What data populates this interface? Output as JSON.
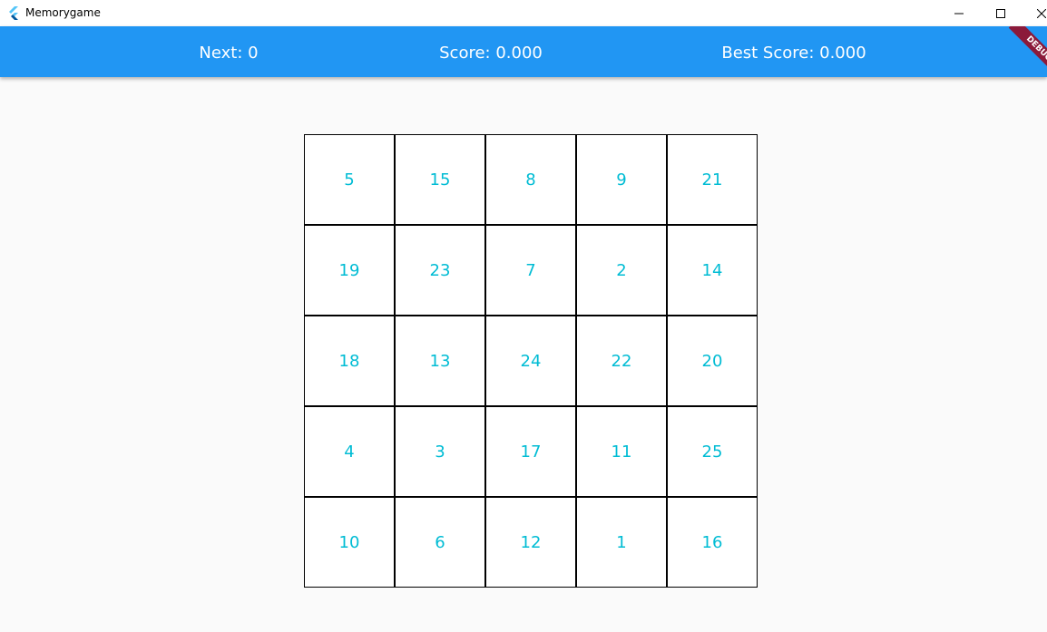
{
  "window": {
    "title": "Memorygame",
    "controls": [
      "minimize-icon",
      "maximize-icon",
      "close-icon"
    ]
  },
  "appbar": {
    "next": "Next: 0",
    "score": "Score: 0.000",
    "best_score": "Best Score: 0.000",
    "debug_banner": "DEBUG",
    "color": "#2196f3"
  },
  "board": {
    "text_color": "#00bcd4",
    "cells": [
      "5",
      "15",
      "8",
      "9",
      "21",
      "19",
      "23",
      "7",
      "2",
      "14",
      "18",
      "13",
      "24",
      "22",
      "20",
      "4",
      "3",
      "17",
      "11",
      "25",
      "10",
      "6",
      "12",
      "1",
      "16"
    ]
  }
}
